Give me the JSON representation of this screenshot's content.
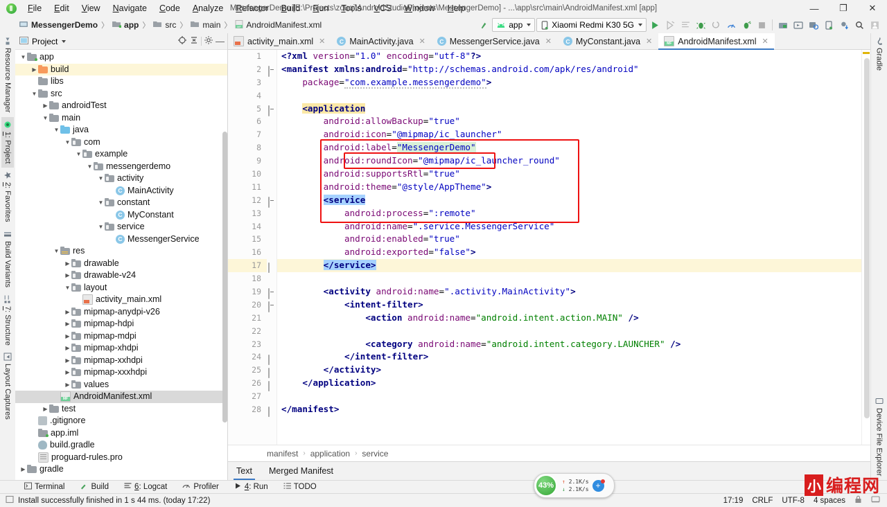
{
  "window": {
    "title": "MessengerDemo [E:\\Projects\\zouqi\\AndroidStudioProjects\\MessengerDemo] - ...\\app\\src\\main\\AndroidManifest.xml [app]",
    "minimize": "—",
    "maximize": "❐",
    "close": "✕"
  },
  "menu": [
    "File",
    "Edit",
    "View",
    "Navigate",
    "Code",
    "Analyze",
    "Refactor",
    "Build",
    "Run",
    "Tools",
    "VCS",
    "Window",
    "Help"
  ],
  "breadcrumb_nav": [
    "MessengerDemo",
    "app",
    "src",
    "main",
    "AndroidManifest.xml"
  ],
  "toolbar": {
    "module_label": "app",
    "device_label": "Xiaomi Redmi K30 5G",
    "buttons": [
      "run-button",
      "apply-changes-button",
      "apply-code-changes-button",
      "debug-button",
      "attach-debugger-button",
      "profiler-button",
      "run-with-coverage-button",
      "stop-button",
      "sdk-manager-button",
      "avd-manager-button",
      "layout-inspector-button",
      "device-manager-button",
      "sync-gradle-button",
      "search-button",
      "user-button"
    ]
  },
  "left_bar": [
    {
      "label": "Resource Manager",
      "icon": "resource-manager-icon",
      "selected": false
    },
    {
      "label": "1: Project",
      "icon": "project-icon",
      "selected": true
    },
    {
      "label": "2: Favorites",
      "icon": "star-icon",
      "selected": false
    },
    {
      "label": "Build Variants",
      "icon": "build-variants-icon",
      "selected": false
    },
    {
      "label": "7: Structure",
      "icon": "structure-icon",
      "selected": false
    },
    {
      "label": "Layout Captures",
      "icon": "layout-captures-icon",
      "selected": false
    }
  ],
  "right_bar": [
    {
      "label": "Gradle",
      "icon": "gradle-icon"
    },
    {
      "label": "Device File Explorer",
      "icon": "device-file-explorer-icon"
    }
  ],
  "project_panel": {
    "title": "Project",
    "tools": [
      "locate-icon",
      "collapse-all-icon",
      "settings-gear-icon",
      "hide-icon"
    ],
    "tree": [
      {
        "label": "app",
        "depth": 1,
        "arrow": "down",
        "icon": "module-folder",
        "state": "normal"
      },
      {
        "label": "build",
        "depth": 2,
        "arrow": "right",
        "icon": "folder-orange",
        "state": "highlight"
      },
      {
        "label": "libs",
        "depth": 2,
        "arrow": "none",
        "icon": "folder-gray",
        "state": "normal"
      },
      {
        "label": "src",
        "depth": 2,
        "arrow": "down",
        "icon": "folder-gray",
        "state": "normal"
      },
      {
        "label": "androidTest",
        "depth": 3,
        "arrow": "right",
        "icon": "folder-gray",
        "state": "normal"
      },
      {
        "label": "main",
        "depth": 3,
        "arrow": "down",
        "icon": "folder-gray",
        "state": "normal"
      },
      {
        "label": "java",
        "depth": 4,
        "arrow": "down",
        "icon": "folder-blue",
        "state": "normal"
      },
      {
        "label": "com",
        "depth": 5,
        "arrow": "down",
        "icon": "folder-package",
        "state": "normal"
      },
      {
        "label": "example",
        "depth": 6,
        "arrow": "down",
        "icon": "folder-package",
        "state": "normal"
      },
      {
        "label": "messengerdemo",
        "depth": 7,
        "arrow": "down",
        "icon": "folder-package",
        "state": "normal"
      },
      {
        "label": "activity",
        "depth": 8,
        "arrow": "down",
        "icon": "folder-package",
        "state": "normal"
      },
      {
        "label": "MainActivity",
        "depth": 9,
        "arrow": "none",
        "icon": "java-class",
        "state": "normal"
      },
      {
        "label": "constant",
        "depth": 8,
        "arrow": "down",
        "icon": "folder-package",
        "state": "normal"
      },
      {
        "label": "MyConstant",
        "depth": 9,
        "arrow": "none",
        "icon": "java-class",
        "state": "normal"
      },
      {
        "label": "service",
        "depth": 8,
        "arrow": "down",
        "icon": "folder-package",
        "state": "normal"
      },
      {
        "label": "MessengerService",
        "depth": 9,
        "arrow": "none",
        "icon": "java-class",
        "state": "normal"
      },
      {
        "label": "res",
        "depth": 4,
        "arrow": "down",
        "icon": "folder-res",
        "state": "normal"
      },
      {
        "label": "drawable",
        "depth": 5,
        "arrow": "right",
        "icon": "folder-package",
        "state": "normal"
      },
      {
        "label": "drawable-v24",
        "depth": 5,
        "arrow": "right",
        "icon": "folder-package",
        "state": "normal"
      },
      {
        "label": "layout",
        "depth": 5,
        "arrow": "down",
        "icon": "folder-package",
        "state": "normal"
      },
      {
        "label": "activity_main.xml",
        "depth": 6,
        "arrow": "none",
        "icon": "xml-layout",
        "state": "normal"
      },
      {
        "label": "mipmap-anydpi-v26",
        "depth": 5,
        "arrow": "right",
        "icon": "folder-package",
        "state": "normal"
      },
      {
        "label": "mipmap-hdpi",
        "depth": 5,
        "arrow": "right",
        "icon": "folder-package",
        "state": "normal"
      },
      {
        "label": "mipmap-mdpi",
        "depth": 5,
        "arrow": "right",
        "icon": "folder-package",
        "state": "normal"
      },
      {
        "label": "mipmap-xhdpi",
        "depth": 5,
        "arrow": "right",
        "icon": "folder-package",
        "state": "normal"
      },
      {
        "label": "mipmap-xxhdpi",
        "depth": 5,
        "arrow": "right",
        "icon": "folder-package",
        "state": "normal"
      },
      {
        "label": "mipmap-xxxhdpi",
        "depth": 5,
        "arrow": "right",
        "icon": "folder-package",
        "state": "normal"
      },
      {
        "label": "values",
        "depth": 5,
        "arrow": "right",
        "icon": "folder-package",
        "state": "normal"
      },
      {
        "label": "AndroidManifest.xml",
        "depth": 4,
        "arrow": "none",
        "icon": "manifest-file",
        "state": "selected"
      },
      {
        "label": "test",
        "depth": 3,
        "arrow": "right",
        "icon": "folder-gray",
        "state": "normal"
      },
      {
        "label": ".gitignore",
        "depth": 2,
        "arrow": "none",
        "icon": "git-file",
        "state": "normal"
      },
      {
        "label": "app.iml",
        "depth": 2,
        "arrow": "none",
        "icon": "iml-file",
        "state": "normal"
      },
      {
        "label": "build.gradle",
        "depth": 2,
        "arrow": "none",
        "icon": "gradle-file",
        "state": "normal"
      },
      {
        "label": "proguard-rules.pro",
        "depth": 2,
        "arrow": "none",
        "icon": "text-file",
        "state": "normal"
      },
      {
        "label": "gradle",
        "depth": 1,
        "arrow": "right",
        "icon": "folder-gray",
        "state": "normal"
      }
    ]
  },
  "editor_tabs": [
    {
      "label": "activity_main.xml",
      "icon": "xml-layout-icon",
      "active": false
    },
    {
      "label": "MainActivity.java",
      "icon": "java-class-icon",
      "active": false
    },
    {
      "label": "MessengerService.java",
      "icon": "java-class-icon",
      "active": false
    },
    {
      "label": "MyConstant.java",
      "icon": "java-class-icon",
      "active": false
    },
    {
      "label": "AndroidManifest.xml",
      "icon": "manifest-icon",
      "active": true
    }
  ],
  "code": {
    "current_line": 17,
    "lines": [
      {
        "n": 1,
        "html": "<span class=\"t-pi\">&lt;?xml</span> <span class=\"t-attr\">version</span><span class=\"t-eq\">=</span><span class=\"t-str\">\"1.0\"</span> <span class=\"t-attr\">encoding</span><span class=\"t-eq\">=</span><span class=\"t-str\">\"utf-8\"</span><span class=\"t-pi\">?&gt;</span>",
        "indent": 0
      },
      {
        "n": 2,
        "html": "<span class=\"t-tag\">&lt;manifest</span> <span class=\"t-ns\">xmlns:android</span><span class=\"t-eq\">=</span><span class=\"t-str\">\"http://schemas.android.com/apk/res/android\"</span>",
        "indent": 0
      },
      {
        "n": 3,
        "html": "    <span class=\"t-attr\">package</span><span class=\"t-eq\">=</span><span class=\"t-str wavy\">\"com.example.messengerdemo\"</span><span class=\"t-tag\">&gt;</span>",
        "indent": 0
      },
      {
        "n": 4,
        "html": "",
        "indent": 0
      },
      {
        "n": 5,
        "html": "    <span class=\"t-tag hl-tag\">&lt;application</span>",
        "indent": 0
      },
      {
        "n": 6,
        "html": "        <span class=\"t-attr\">android:allowBackup</span><span class=\"t-eq\">=</span><span class=\"t-str\">\"true\"</span>",
        "indent": 0
      },
      {
        "n": 7,
        "html": "        <span class=\"t-attr\">android:icon</span><span class=\"t-eq\">=</span><span class=\"t-str\">\"@mipmap/ic_launcher\"</span>",
        "indent": 0
      },
      {
        "n": 8,
        "html": "        <span class=\"t-attr\">android:label</span><span class=\"t-eq\">=</span><span class=\"t-str hl-str\">\"MessengerDemo\"</span>",
        "indent": 0
      },
      {
        "n": 9,
        "html": "        <span class=\"t-attr\">android:roundIcon</span><span class=\"t-eq\">=</span><span class=\"t-str\">\"@mipmap/ic_launcher_round\"</span>",
        "indent": 0
      },
      {
        "n": 10,
        "html": "        <span class=\"t-attr\">android:supportsRtl</span><span class=\"t-eq\">=</span><span class=\"t-str\">\"true\"</span>",
        "indent": 0
      },
      {
        "n": 11,
        "html": "        <span class=\"t-attr\">android:theme</span><span class=\"t-eq\">=</span><span class=\"t-str\">\"@style/AppTheme\"</span><span class=\"t-tag\">&gt;</span>",
        "indent": 0
      },
      {
        "n": 12,
        "html": "        <span class=\"t-tag hl-sel\">&lt;service</span>",
        "indent": 0
      },
      {
        "n": 13,
        "html": "            <span class=\"t-attr\">android:process</span><span class=\"t-eq\">=</span><span class=\"t-str\">\":remote\"</span>",
        "indent": 0
      },
      {
        "n": 14,
        "html": "            <span class=\"t-attr\">android:name</span><span class=\"t-eq\">=</span><span class=\"t-str\">\".service.MessengerService\"</span>",
        "indent": 0
      },
      {
        "n": 15,
        "html": "            <span class=\"t-attr\">android:enabled</span><span class=\"t-eq\">=</span><span class=\"t-str\">\"true\"</span>",
        "indent": 0
      },
      {
        "n": 16,
        "html": "            <span class=\"t-attr\">android:exported</span><span class=\"t-eq\">=</span><span class=\"t-str\">\"false\"</span><span class=\"t-tag\">&gt;</span>",
        "indent": 0
      },
      {
        "n": 17,
        "html": "        <span class=\"t-tag hl-sel\">&lt;/service&gt;</span>",
        "indent": 0
      },
      {
        "n": 18,
        "html": "",
        "indent": 0
      },
      {
        "n": 19,
        "html": "        <span class=\"t-tag\">&lt;activity</span> <span class=\"t-attr\">android:name</span><span class=\"t-eq\">=</span><span class=\"t-str\">\".activity.MainActivity\"</span><span class=\"t-tag\">&gt;</span>",
        "indent": 0
      },
      {
        "n": 20,
        "html": "            <span class=\"t-tag\">&lt;intent-filter&gt;</span>",
        "indent": 0
      },
      {
        "n": 21,
        "html": "                <span class=\"t-tag\">&lt;action</span> <span class=\"t-attr\">android:name</span><span class=\"t-eq\">=</span><span class=\"t-strg\">\"android.intent.action.MAIN\"</span> <span class=\"t-tag\">/&gt;</span>",
        "indent": 0
      },
      {
        "n": 22,
        "html": "",
        "indent": 0
      },
      {
        "n": 23,
        "html": "                <span class=\"t-tag\">&lt;category</span> <span class=\"t-attr\">android:name</span><span class=\"t-eq\">=</span><span class=\"t-strg\">\"android.intent.category.LAUNCHER\"</span> <span class=\"t-tag\">/&gt;</span>",
        "indent": 0
      },
      {
        "n": 24,
        "html": "            <span class=\"t-tag\">&lt;/intent-filter&gt;</span>",
        "indent": 0
      },
      {
        "n": 25,
        "html": "        <span class=\"t-tag\">&lt;/activity&gt;</span>",
        "indent": 0
      },
      {
        "n": 26,
        "html": "    <span class=\"t-tag\">&lt;/application&gt;</span>",
        "indent": 0
      },
      {
        "n": 27,
        "html": "",
        "indent": 0
      },
      {
        "n": 28,
        "html": "<span class=\"t-tag\">&lt;/manifest&gt;</span>",
        "indent": 0
      }
    ]
  },
  "annotations": {
    "outer_box_label": "service-block-highlight",
    "inner_box_label": "android-process-highlight",
    "color": "#ee1111"
  },
  "editor_breadcrumb": [
    "manifest",
    "application",
    "service"
  ],
  "editor_bottom_tabs": [
    {
      "label": "Text",
      "active": true
    },
    {
      "label": "Merged Manifest",
      "active": false
    }
  ],
  "tool_windows": [
    {
      "label": "Terminal",
      "icon": "terminal-icon"
    },
    {
      "label": "Build",
      "icon": "build-hammer-icon"
    },
    {
      "label": "6: Logcat",
      "icon": "logcat-icon"
    },
    {
      "label": "Profiler",
      "icon": "profiler-icon"
    },
    {
      "label": "4: Run",
      "icon": "run-icon"
    },
    {
      "label": "TODO",
      "icon": "todo-icon"
    }
  ],
  "status_bar": {
    "message": "Install successfully finished in 1 s 44 ms. (today 17:22)",
    "time": "17:19",
    "line_sep": "CRLF",
    "encoding": "UTF-8",
    "indent": "4 spaces",
    "icons": [
      "lock-icon",
      "event-log-icon"
    ]
  },
  "floating": {
    "speed_percent": "43%",
    "upload_rate": "2.1K/s",
    "download_rate": "2.1K/s",
    "plus_label": "+"
  },
  "watermark": {
    "mark": "小",
    "text": "编程网"
  }
}
